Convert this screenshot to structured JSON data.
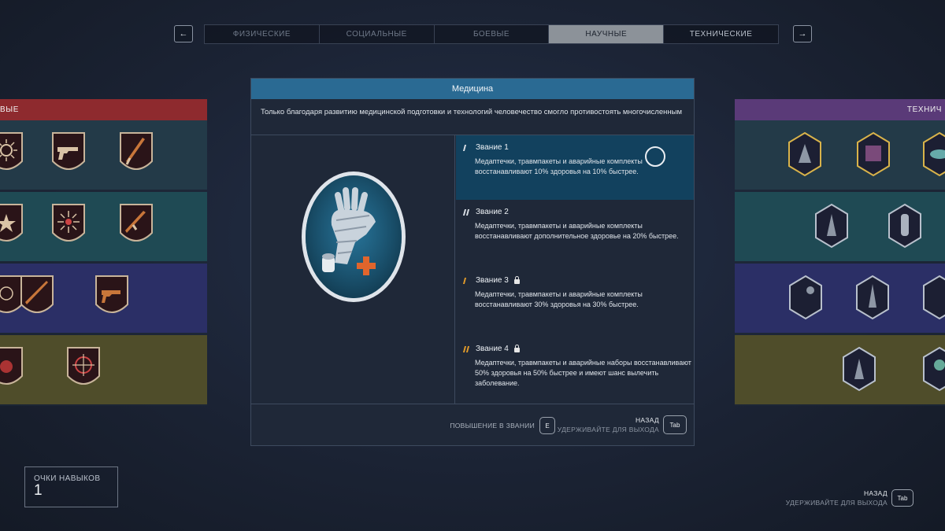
{
  "tabs": [
    {
      "label": "ФИЗИЧЕСКИЕ",
      "active": false
    },
    {
      "label": "СОЦИАЛЬНЫЕ",
      "active": false
    },
    {
      "label": "БОЕВЫЕ",
      "active": false
    },
    {
      "label": "НАУЧНЫЕ",
      "active": true
    },
    {
      "label": "ТЕХНИЧЕСКИЕ",
      "active": false
    }
  ],
  "nav": {
    "prev_icon": "arrow-left-icon",
    "next_icon": "arrow-right-icon"
  },
  "left_panel": {
    "header": "ВЫЕ",
    "color": "#8e2a2e"
  },
  "right_panel": {
    "header": "ТЕХНИЧ",
    "color": "#5a3a78"
  },
  "skill": {
    "title": "Медицина",
    "description": "Только благодаря развитию медицинской подготовки и технологий человечество смогло противостоять многочисленным",
    "badge_icon": "bandaged-hand-icon",
    "ranks": [
      {
        "title": "Звание 1",
        "locked": false,
        "selected": true,
        "pip_color": "white",
        "pips": 1,
        "text": "Медаптечки, травмпакеты и аварийные комплекты восстанавливают 10% здоровья на 10% быстрее."
      },
      {
        "title": "Звание 2",
        "locked": false,
        "selected": false,
        "pip_color": "white",
        "pips": 2,
        "text": "Медаптечки, травмпакеты и аварийные комплекты восстанавливают дополнительное здоровье на 20% быстрее."
      },
      {
        "title": "Звание 3",
        "locked": true,
        "selected": false,
        "pip_color": "orange",
        "pips": 1,
        "text": "Медаптечки, травмпакеты и аварийные комплекты восстанавливают 30% здоровья на 30% быстрее."
      },
      {
        "title": "Звание 4",
        "locked": true,
        "selected": false,
        "pip_color": "orange",
        "pips": 2,
        "text": "Медаптечки, травмпакеты и аварийные наборы восстанавливают 50% здоровья на 50% быстрее и имеют шанс вылечить заболевание."
      }
    ]
  },
  "dialog_footer": {
    "promote_label": "ПОВЫШЕНИЕ В ЗВАНИИ",
    "promote_key": "E",
    "back_label": "НАЗАД",
    "back_hint": "УДЕРЖИВАЙТЕ ДЛЯ ВЫХОДА",
    "back_key": "Tab"
  },
  "skill_points": {
    "label": "ОЧКИ НАВЫКОВ",
    "value": "1"
  },
  "screen_footer": {
    "back_label": "НАЗАД",
    "back_hint": "УДЕРЖИВАЙТЕ ДЛЯ ВЫХОДА",
    "back_key": "Tab"
  },
  "colors": {
    "accent_blue": "#2a6a93",
    "selected_rank": "#12415e",
    "locked_pip": "#e09a2a",
    "active_tab": "#8c9299"
  }
}
